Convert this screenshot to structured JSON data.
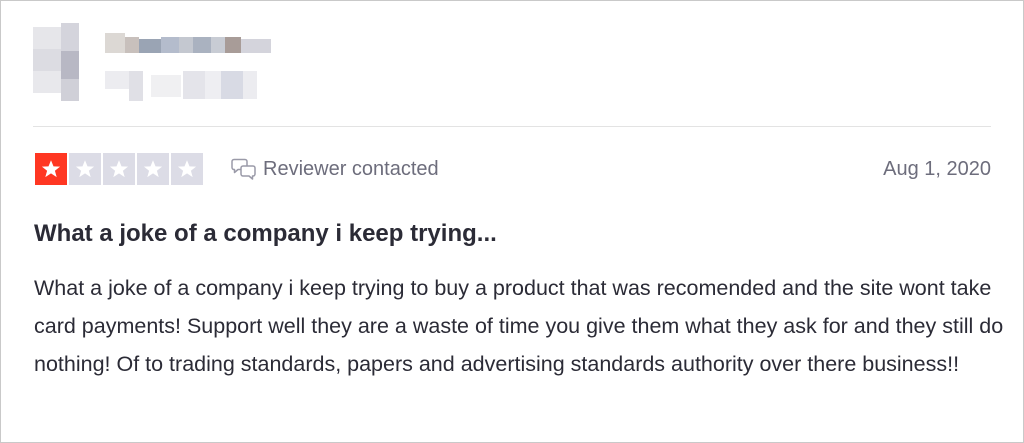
{
  "review": {
    "rating": 1,
    "rating_max": 5,
    "contacted_label": "Reviewer contacted",
    "date": "Aug 1, 2020",
    "title": "What a joke of a company i keep trying...",
    "body": "What a joke of a company i keep trying to buy a product that was recomended and the site wont take card payments! Support well they are a waste of time you give them what they ask for and they still do nothing! Of to trading standards, papers and advertising standards authority over there business!!"
  },
  "colors": {
    "star_active": "#ff3722",
    "star_inactive": "#dcdce6",
    "muted_text": "#6d6d7c",
    "primary_text": "#2b2b36"
  },
  "icons": {
    "star": "star-icon",
    "contacted": "chat-bubbles-icon"
  }
}
